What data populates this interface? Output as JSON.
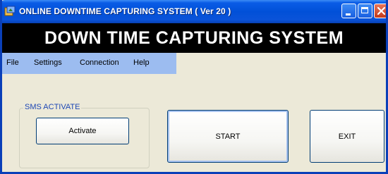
{
  "window": {
    "title": "ONLINE DOWNTIME CAPTURING SYSTEM ( Ver 20 )",
    "icon": "app-icon"
  },
  "banner": {
    "text": "DOWN TIME CAPTURING SYSTEM"
  },
  "menu": {
    "items": [
      {
        "label": "File"
      },
      {
        "label": "Settings"
      },
      {
        "label": "Connection"
      },
      {
        "label": "Help"
      }
    ]
  },
  "sms_group": {
    "label": "SMS ACTIVATE",
    "activate_label": "Activate"
  },
  "buttons": {
    "start_label": "START",
    "exit_label": "EXIT"
  },
  "colors": {
    "titlebar": "#0150d8",
    "banner_bg": "#000000",
    "banner_text": "#ffffff",
    "menubar_bg": "#9cbcf0",
    "window_bg": "#ece9d8",
    "group_label": "#1d47b4"
  }
}
